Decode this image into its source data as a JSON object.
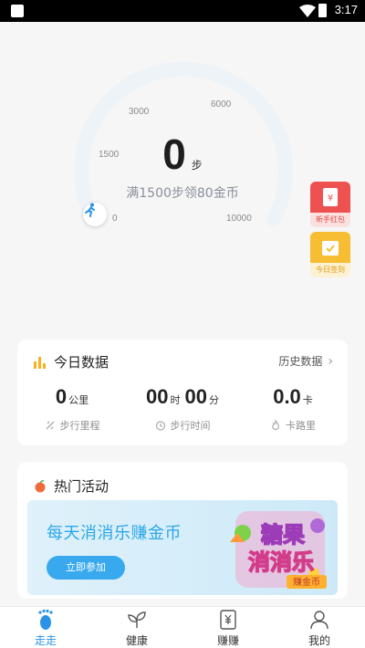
{
  "status_bar": {
    "time": "3:17"
  },
  "gauge": {
    "steps": "0",
    "unit": "步",
    "goal_text": "满1500步领80金币",
    "ticks": [
      "0",
      "1500",
      "3000",
      "6000",
      "10000"
    ],
    "progress_fraction": 0,
    "track_color": "#eef3f8"
  },
  "badges": {
    "newbie_packet": "新手红包",
    "today_signin": "今日签到"
  },
  "today_data": {
    "title": "今日数据",
    "history_link": "历史数据",
    "stats": [
      {
        "value": "0",
        "unit": "公里",
        "label": "步行里程"
      },
      {
        "value": "00",
        "unit": "时",
        "value2": "00",
        "unit2": "分",
        "label": "步行时间"
      },
      {
        "value": "0.0",
        "unit": "卡",
        "label": "卡路里"
      }
    ]
  },
  "hot_activities": {
    "title": "热门活动",
    "banner_text": "每天消消乐赚金币",
    "banner_button": "立即参加",
    "art_title_top": "糖果",
    "art_title_bottom": "消消乐",
    "art_ribbon": "赚金币"
  },
  "nav": [
    {
      "label": "走走",
      "icon": "footprint-icon",
      "active": true
    },
    {
      "label": "健康",
      "icon": "leaf-icon",
      "active": false
    },
    {
      "label": "赚赚",
      "icon": "yen-card-icon",
      "active": false
    },
    {
      "label": "我的",
      "icon": "person-icon",
      "active": false
    }
  ],
  "colors": {
    "accent": "#2a93e8",
    "red_badge": "#ee5250",
    "yellow_badge": "#f7be33",
    "banner_button": "#38a9ee"
  }
}
